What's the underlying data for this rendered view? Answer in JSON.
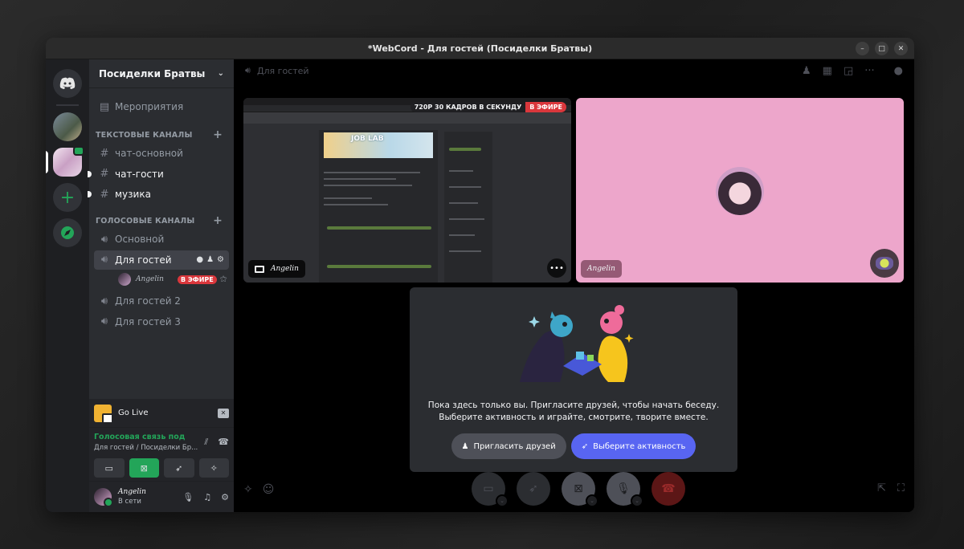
{
  "window": {
    "title": "*WebCord - Для гостей (Посиделки Братвы)"
  },
  "guild": {
    "name": "Посиделки Братвы"
  },
  "sidebar": {
    "events_label": "Мероприятия",
    "text_category": "ТЕКСТОВЫЕ КАНАЛЫ",
    "text_channels": [
      "чат-основной",
      "чат-гости",
      "музика"
    ],
    "voice_category": "ГОЛОСОВЫЕ КАНАЛЫ",
    "voice_channels": [
      "Основной",
      "Для гостей",
      "Для гостей 2",
      "Для гостей 3"
    ],
    "voice_user": {
      "name": "Angelin",
      "live": "В ЭФИРЕ"
    }
  },
  "golive": {
    "label": "Go Live"
  },
  "voice_panel": {
    "status": "Голосовая связь под",
    "location": "Для гостей / Посиделки Бр..."
  },
  "user_panel": {
    "name": "Angelin",
    "status": "В сети"
  },
  "main": {
    "channel": "Для гостей",
    "stream": {
      "quality": "720P 30 КАДРОВ В СЕКУНДУ",
      "live": "В ЭФИРЕ",
      "user": "Angelin",
      "banner": "JOB LAB"
    },
    "cam_user": "Angelin",
    "invite": {
      "line1": "Пока здесь только вы. Пригласите друзей, чтобы начать беседу.",
      "line2": "Выберите активность и играйте, смотрите, творите вместе.",
      "invite_btn": "Пригласить друзей",
      "activity_btn": "Выберите активность"
    }
  },
  "colors": {
    "accent": "#5865f2",
    "live": "#da373c",
    "online": "#23a559"
  }
}
